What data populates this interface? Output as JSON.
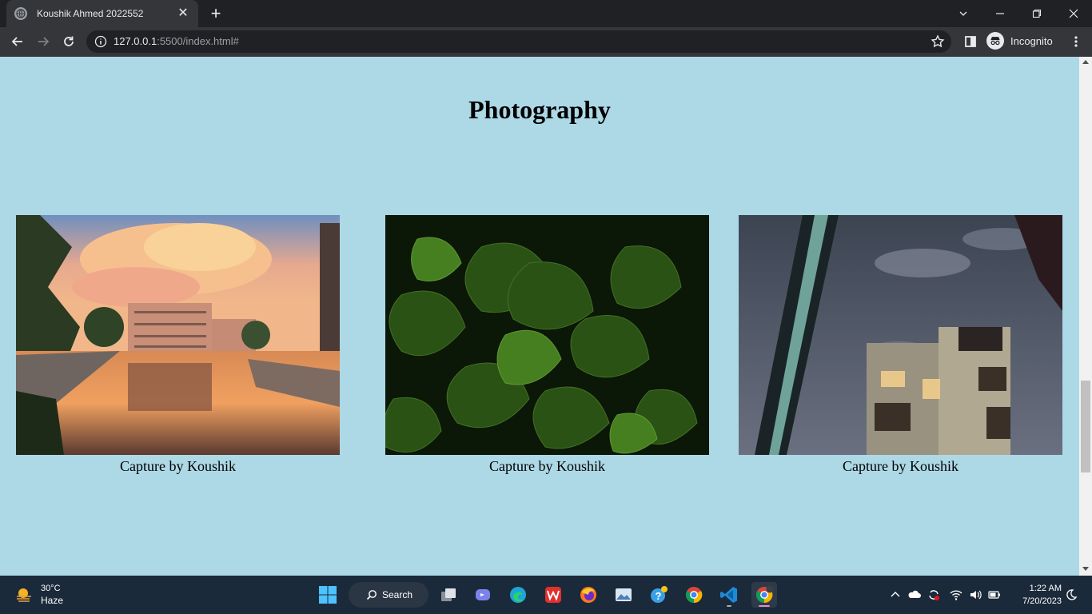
{
  "browser": {
    "tab_title": "Koushik Ahmed 2022552",
    "url_host": "127.0.0.1",
    "url_rest": ":5500/index.html#",
    "profile_label": "Incognito"
  },
  "page": {
    "heading": "Photography",
    "photos": [
      {
        "caption": "Capture by Koushik",
        "subject": "sunset-building-reflection"
      },
      {
        "caption": "Capture by Koushik",
        "subject": "green-leaves"
      },
      {
        "caption": "Capture by Koushik",
        "subject": "night-building"
      }
    ],
    "background_color": "#add8e6"
  },
  "taskbar": {
    "weather_temp": "30°C",
    "weather_desc": "Haze",
    "search_label": "Search",
    "time": "1:22 AM",
    "date": "7/20/2023"
  }
}
